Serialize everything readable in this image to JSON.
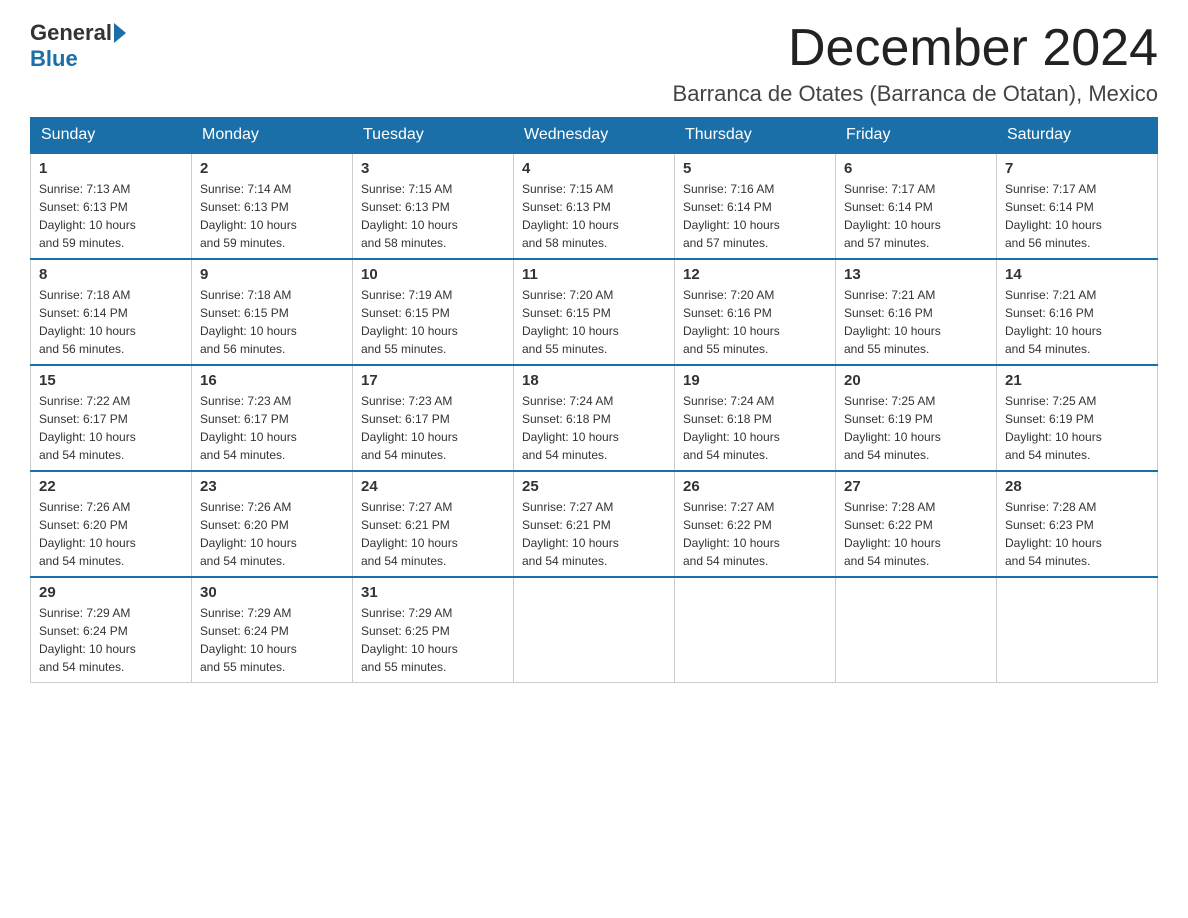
{
  "logo": {
    "general": "General",
    "blue": "Blue",
    "subtitle": "Blue"
  },
  "title": "December 2024",
  "location": "Barranca de Otates (Barranca de Otatan), Mexico",
  "weekdays": [
    "Sunday",
    "Monday",
    "Tuesday",
    "Wednesday",
    "Thursday",
    "Friday",
    "Saturday"
  ],
  "weeks": [
    [
      {
        "day": "1",
        "sunrise": "7:13 AM",
        "sunset": "6:13 PM",
        "daylight": "10 hours and 59 minutes."
      },
      {
        "day": "2",
        "sunrise": "7:14 AM",
        "sunset": "6:13 PM",
        "daylight": "10 hours and 59 minutes."
      },
      {
        "day": "3",
        "sunrise": "7:15 AM",
        "sunset": "6:13 PM",
        "daylight": "10 hours and 58 minutes."
      },
      {
        "day": "4",
        "sunrise": "7:15 AM",
        "sunset": "6:13 PM",
        "daylight": "10 hours and 58 minutes."
      },
      {
        "day": "5",
        "sunrise": "7:16 AM",
        "sunset": "6:14 PM",
        "daylight": "10 hours and 57 minutes."
      },
      {
        "day": "6",
        "sunrise": "7:17 AM",
        "sunset": "6:14 PM",
        "daylight": "10 hours and 57 minutes."
      },
      {
        "day": "7",
        "sunrise": "7:17 AM",
        "sunset": "6:14 PM",
        "daylight": "10 hours and 56 minutes."
      }
    ],
    [
      {
        "day": "8",
        "sunrise": "7:18 AM",
        "sunset": "6:14 PM",
        "daylight": "10 hours and 56 minutes."
      },
      {
        "day": "9",
        "sunrise": "7:18 AM",
        "sunset": "6:15 PM",
        "daylight": "10 hours and 56 minutes."
      },
      {
        "day": "10",
        "sunrise": "7:19 AM",
        "sunset": "6:15 PM",
        "daylight": "10 hours and 55 minutes."
      },
      {
        "day": "11",
        "sunrise": "7:20 AM",
        "sunset": "6:15 PM",
        "daylight": "10 hours and 55 minutes."
      },
      {
        "day": "12",
        "sunrise": "7:20 AM",
        "sunset": "6:16 PM",
        "daylight": "10 hours and 55 minutes."
      },
      {
        "day": "13",
        "sunrise": "7:21 AM",
        "sunset": "6:16 PM",
        "daylight": "10 hours and 55 minutes."
      },
      {
        "day": "14",
        "sunrise": "7:21 AM",
        "sunset": "6:16 PM",
        "daylight": "10 hours and 54 minutes."
      }
    ],
    [
      {
        "day": "15",
        "sunrise": "7:22 AM",
        "sunset": "6:17 PM",
        "daylight": "10 hours and 54 minutes."
      },
      {
        "day": "16",
        "sunrise": "7:23 AM",
        "sunset": "6:17 PM",
        "daylight": "10 hours and 54 minutes."
      },
      {
        "day": "17",
        "sunrise": "7:23 AM",
        "sunset": "6:17 PM",
        "daylight": "10 hours and 54 minutes."
      },
      {
        "day": "18",
        "sunrise": "7:24 AM",
        "sunset": "6:18 PM",
        "daylight": "10 hours and 54 minutes."
      },
      {
        "day": "19",
        "sunrise": "7:24 AM",
        "sunset": "6:18 PM",
        "daylight": "10 hours and 54 minutes."
      },
      {
        "day": "20",
        "sunrise": "7:25 AM",
        "sunset": "6:19 PM",
        "daylight": "10 hours and 54 minutes."
      },
      {
        "day": "21",
        "sunrise": "7:25 AM",
        "sunset": "6:19 PM",
        "daylight": "10 hours and 54 minutes."
      }
    ],
    [
      {
        "day": "22",
        "sunrise": "7:26 AM",
        "sunset": "6:20 PM",
        "daylight": "10 hours and 54 minutes."
      },
      {
        "day": "23",
        "sunrise": "7:26 AM",
        "sunset": "6:20 PM",
        "daylight": "10 hours and 54 minutes."
      },
      {
        "day": "24",
        "sunrise": "7:27 AM",
        "sunset": "6:21 PM",
        "daylight": "10 hours and 54 minutes."
      },
      {
        "day": "25",
        "sunrise": "7:27 AM",
        "sunset": "6:21 PM",
        "daylight": "10 hours and 54 minutes."
      },
      {
        "day": "26",
        "sunrise": "7:27 AM",
        "sunset": "6:22 PM",
        "daylight": "10 hours and 54 minutes."
      },
      {
        "day": "27",
        "sunrise": "7:28 AM",
        "sunset": "6:22 PM",
        "daylight": "10 hours and 54 minutes."
      },
      {
        "day": "28",
        "sunrise": "7:28 AM",
        "sunset": "6:23 PM",
        "daylight": "10 hours and 54 minutes."
      }
    ],
    [
      {
        "day": "29",
        "sunrise": "7:29 AM",
        "sunset": "6:24 PM",
        "daylight": "10 hours and 54 minutes."
      },
      {
        "day": "30",
        "sunrise": "7:29 AM",
        "sunset": "6:24 PM",
        "daylight": "10 hours and 55 minutes."
      },
      {
        "day": "31",
        "sunrise": "7:29 AM",
        "sunset": "6:25 PM",
        "daylight": "10 hours and 55 minutes."
      },
      null,
      null,
      null,
      null
    ]
  ],
  "labels": {
    "sunrise": "Sunrise: ",
    "sunset": "Sunset: ",
    "daylight": "Daylight: "
  }
}
